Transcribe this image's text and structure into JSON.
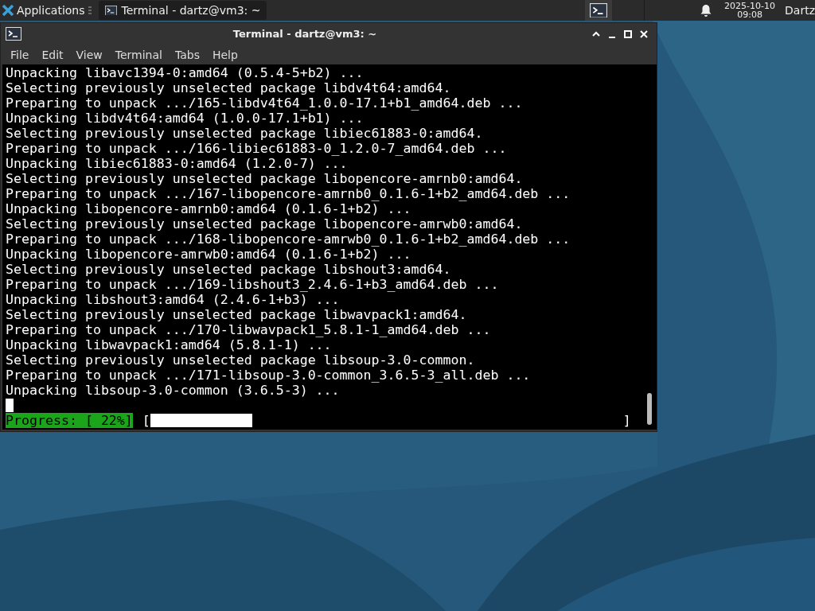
{
  "panel": {
    "apps_label": "Applications",
    "tasks": [
      {
        "title": "Terminal - dartz@vm3: ~",
        "selected": true
      }
    ],
    "clock_date": "2025-10-10",
    "clock_time": "09:08",
    "user": "Dartz"
  },
  "window": {
    "title": "Terminal - dartz@vm3: ~",
    "menu": [
      "File",
      "Edit",
      "View",
      "Terminal",
      "Tabs",
      "Help"
    ],
    "lines": [
      "Unpacking libavc1394-0:amd64 (0.5.4-5+b2) ...",
      "Selecting previously unselected package libdv4t64:amd64.",
      "Preparing to unpack .../165-libdv4t64_1.0.0-17.1+b1_amd64.deb ...",
      "Unpacking libdv4t64:amd64 (1.0.0-17.1+b1) ...",
      "Selecting previously unselected package libiec61883-0:amd64.",
      "Preparing to unpack .../166-libiec61883-0_1.2.0-7_amd64.deb ...",
      "Unpacking libiec61883-0:amd64 (1.2.0-7) ...",
      "Selecting previously unselected package libopencore-amrnb0:amd64.",
      "Preparing to unpack .../167-libopencore-amrnb0_0.1.6-1+b2_amd64.deb ...",
      "Unpacking libopencore-amrnb0:amd64 (0.1.6-1+b2) ...",
      "Selecting previously unselected package libopencore-amrwb0:amd64.",
      "Preparing to unpack .../168-libopencore-amrwb0_0.1.6-1+b2_amd64.deb ...",
      "Unpacking libopencore-amrwb0:amd64 (0.1.6-1+b2) ...",
      "Selecting previously unselected package libshout3:amd64.",
      "Preparing to unpack .../169-libshout3_2.4.6-1+b3_amd64.deb ...",
      "Unpacking libshout3:amd64 (2.4.6-1+b3) ...",
      "Selecting previously unselected package libwavpack1:amd64.",
      "Preparing to unpack .../170-libwavpack1_5.8.1-1_amd64.deb ...",
      "Unpacking libwavpack1:amd64 (5.8.1-1) ...",
      "Selecting previously unselected package libsoup-3.0-common.",
      "Preparing to unpack .../171-libsoup-3.0-common_3.6.5-3_all.deb ...",
      "Unpacking libsoup-3.0-common (3.6.5-3) ..."
    ],
    "progress": {
      "label": "Progress: [ 22%]",
      "open_bracket": "[",
      "close_bracket": "]",
      "level": 0.22
    }
  }
}
